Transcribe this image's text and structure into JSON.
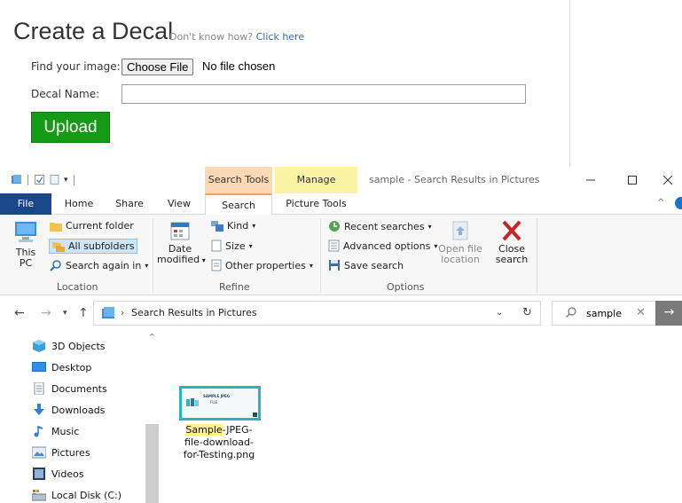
{
  "web": {
    "title": "Create a Decal",
    "help_text": "Don't know how?",
    "help_link": "Click here",
    "image_label": "Find your image:",
    "choose_file_label": "Choose File",
    "no_file_text": "No file chosen",
    "decal_name_label": "Decal Name:",
    "decal_name_value": "",
    "upload_label": "Upload",
    "upload_color": "#149a14"
  },
  "explorer": {
    "window_title": "sample - Search Results in Pictures",
    "context_search": "Search Tools",
    "context_manage": "Manage",
    "context_search_color": "#fbd8b4",
    "context_manage_color": "#fbf3a4",
    "tabs": {
      "file": "File",
      "home": "Home",
      "share": "Share",
      "view": "View",
      "search": "Search",
      "picture_tools": "Picture Tools"
    },
    "ribbon": {
      "this_pc": [
        "This",
        "PC"
      ],
      "current_folder": "Current folder",
      "all_subfolders": "All subfolders",
      "search_again": "Search again in",
      "location_group": "Location",
      "date_modified": [
        "Date",
        "modified"
      ],
      "kind": "Kind",
      "size": "Size",
      "other_properties": "Other properties",
      "refine_group": "Refine",
      "recent_searches": "Recent searches",
      "advanced_options": "Advanced options",
      "save_search": "Save search",
      "open_file_location": [
        "Open file",
        "location"
      ],
      "close_search": [
        "Close",
        "search"
      ],
      "options_group": "Options"
    },
    "address": {
      "path": "Search Results in Pictures"
    },
    "search": {
      "value": "sample"
    },
    "nav_items": [
      "3D Objects",
      "Desktop",
      "Documents",
      "Downloads",
      "Music",
      "Pictures",
      "Videos",
      "Local Disk (C:)"
    ],
    "file": {
      "name_highlight": "Sample",
      "name_line1_rest": "-JPEG-",
      "name_line2": "file-download-",
      "name_line3": "for-Testing.png",
      "thumb_line1": "SAMPLE JPEG",
      "thumb_line2": "FILE"
    }
  }
}
